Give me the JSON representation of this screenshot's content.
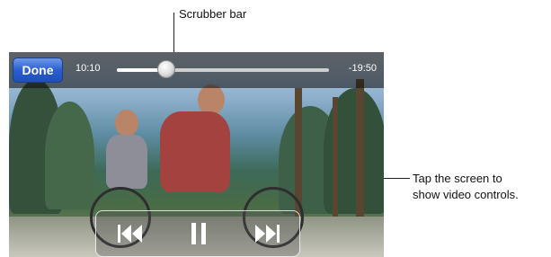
{
  "annotations": {
    "scrubber_label": "Scrubber bar",
    "tap_line1": "Tap the screen to",
    "tap_line2": "show video controls."
  },
  "player": {
    "done_label": "Done",
    "elapsed": "10:10",
    "remaining": "-19:50",
    "progress": 0.235,
    "accent": "#2a5fd0"
  },
  "controls": {
    "previous_icon": "previous-track-icon",
    "pause_icon": "pause-icon",
    "next_icon": "next-track-icon"
  }
}
